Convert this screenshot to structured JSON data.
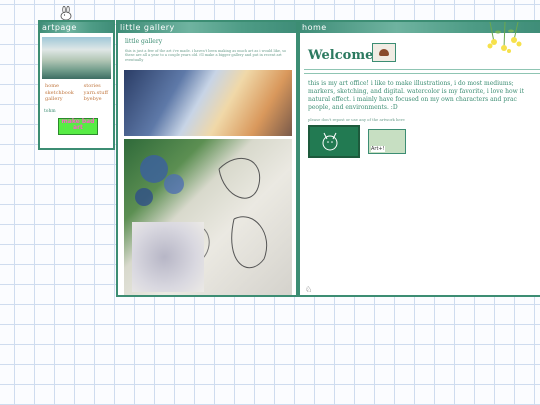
{
  "left": {
    "header": "artpage",
    "links_col1": [
      "home",
      "sketchbook",
      "gallery"
    ],
    "links_col2": [
      "stories",
      "yarn.stuff",
      "byebye"
    ],
    "tohm": "tohm",
    "badge": "make bad art"
  },
  "middle": {
    "header": "little gallery",
    "title": "little gallery",
    "description": "this is just a few of the art i've made. i haven't been making as much art as i would like, so these are all a year to a couple years old. i'll make a bigger gallery and put in recent art eventually"
  },
  "right": {
    "header": "home",
    "welcome": "Welcome!",
    "intro": "this is my art office! i like to make illustrations, i do most mediums; markers, sketching, and digital. watercolor is my favorite, i love how it natural effect. i mainly have focused on my own characters and prac people, and environments. :D",
    "note": "please don't repost or use any of the artwork here",
    "button_label": "Art+!",
    "corner_glyph": "♘"
  },
  "colors": {
    "accent": "#3c8d73",
    "link": "#c0763e",
    "badge_bg": "#57ec45",
    "badge_text": "#ff5bc9"
  }
}
